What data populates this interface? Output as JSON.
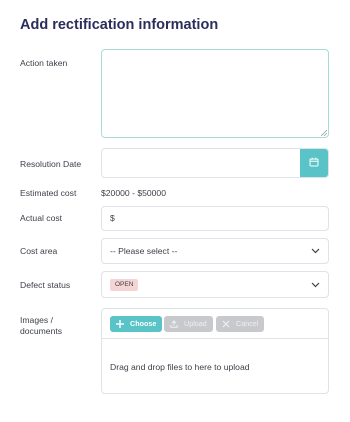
{
  "form": {
    "title": "Add rectification information",
    "labels": {
      "action_taken": "Action taken",
      "resolution_date": "Resolution Date",
      "estimated_cost": "Estimated cost",
      "actual_cost": "Actual cost",
      "cost_area": "Cost area",
      "defect_status": "Defect status",
      "images_line1": "Images /",
      "images_line2": "documents"
    },
    "action_taken_value": "",
    "resolution_date_value": "",
    "estimated_cost_value": "$20000 - $50000",
    "actual_cost_prefix": "$",
    "cost_area_selected": "-- Please select --",
    "defect_status_badge": "OPEN",
    "upload": {
      "choose_label": "Choose",
      "upload_label": "Upload",
      "cancel_label": "Cancel",
      "dropzone_text": "Drag and drop files to here to upload"
    }
  },
  "colors": {
    "title": "#2b2d5a",
    "accent": "#59c3c8",
    "badge_bg": "#f5d5d3",
    "disabled_button": "#c8c9cd",
    "border": "#dfe2e7"
  },
  "icons": {
    "date_button": "calendar-icon",
    "select_arrow": "chevron-down-icon",
    "choose": "plus-icon",
    "upload": "upload-icon",
    "cancel": "close-icon"
  }
}
